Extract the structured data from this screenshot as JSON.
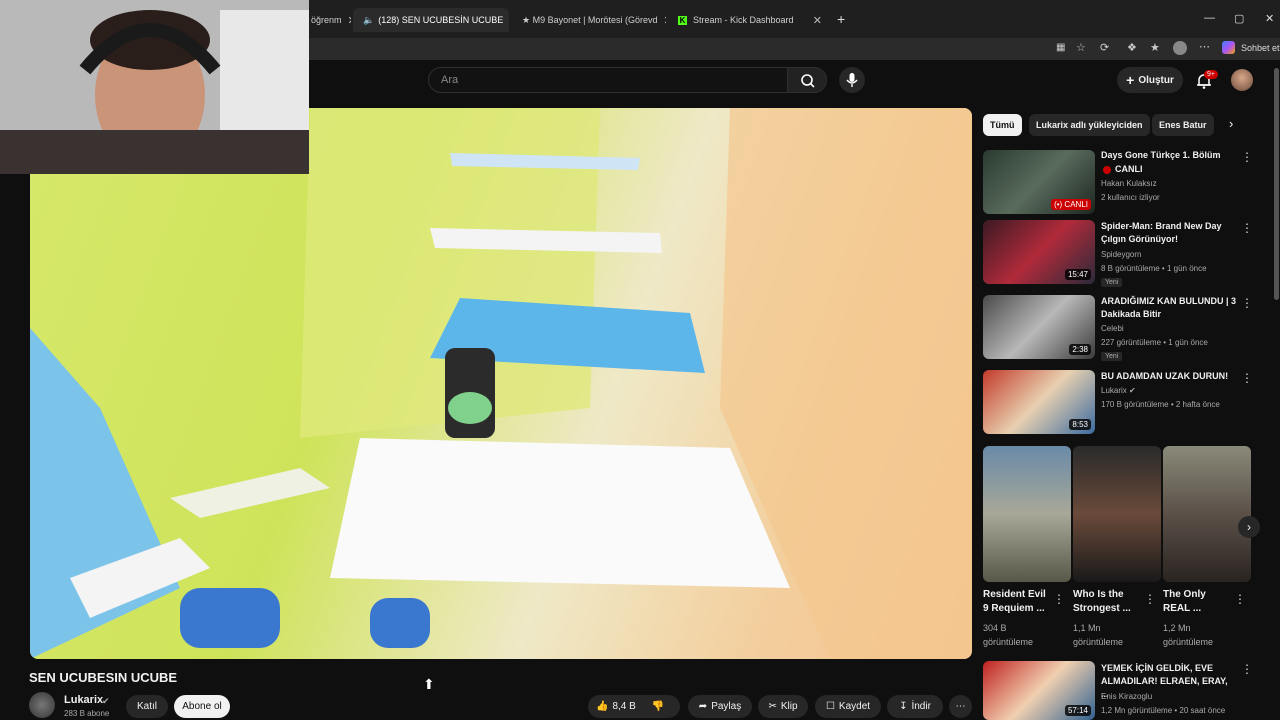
{
  "browser": {
    "tabs": [
      {
        "label": "öğrenm",
        "active": false
      },
      {
        "label": "(128) SEN UCUBESİN UCUBE",
        "active": true
      },
      {
        "label": "★ M9 Bayonet | Morötesi (Görevd",
        "active": false
      },
      {
        "label": "Stream - Kick Dashboard",
        "active": false
      }
    ],
    "new_tab": "+",
    "close_symbol": "✕",
    "sidebar_label": "Sohbet et"
  },
  "header": {
    "search_placeholder": "Ara",
    "create_label": "Oluştur",
    "notif_count": "9+"
  },
  "video": {
    "title": "SEN UCUBESIN UCUBE",
    "channel": "Lukarix",
    "subscribers": "283 B abone",
    "join_label": "Katıl",
    "subscribe_label": "Abone ol",
    "likes": "8,4 B",
    "share_label": "Paylaş",
    "clip_label": "Klip",
    "save_label": "Kaydet",
    "download_label": "İndir"
  },
  "filters": [
    "Tümü",
    "Lukarix adlı yükleyiciden",
    "Enes Batur"
  ],
  "recommendations": [
    {
      "title": "Days Gone Türkçe 1. Bölüm",
      "title2": "CANLI",
      "channel": "Hakan Kulaksız",
      "meta": "2 kullanıcı izliyor",
      "duration": "(•) CANLI",
      "badge": ""
    },
    {
      "title": "Spider-Man: Brand New Day Çılgın Görünüyor!",
      "title2": "",
      "channel": "Spideygorn",
      "meta": "8 B görüntüleme • 1 gün önce",
      "duration": "15:47",
      "badge": "Yeni"
    },
    {
      "title": "ARADIĞIMIZ KAN BULUNDU | 3 Dakikada Bitir",
      "title2": "",
      "channel": "Celebi",
      "meta": "227 görüntüleme • 1 gün önce",
      "duration": "2:38",
      "badge": "Yeni"
    },
    {
      "title": "BU ADAMDAN UZAK DURUN!",
      "title2": "",
      "channel": "Lukarix",
      "meta": "170 B görüntüleme • 2 hafta önce",
      "duration": "8:53",
      "badge": ""
    }
  ],
  "shorts": [
    {
      "title1": "Resident Evil",
      "title2": "9 Requiem ...",
      "views1": "304 B",
      "views2": "görüntüleme"
    },
    {
      "title1": "Who Is the",
      "title2": "Strongest ...",
      "views1": "1,1 Mn",
      "views2": "görüntüleme"
    },
    {
      "title1": "The Only",
      "title2": "REAL ...",
      "views1": "1,2 Mn",
      "views2": "görüntüleme"
    }
  ],
  "last_rec": {
    "title": "YEMEK İÇİN GELDİK, EVE ALMADILAR! ELRAEN, ERAY, ...",
    "channel": "Enis Kirazoglu",
    "meta": "1,2 Mn görüntüleme • 20 saat önce",
    "duration": "57:14"
  },
  "colors": {
    "accent_red": "#ff0000",
    "bg": "#0f0f0f",
    "chip": "#272727",
    "kick_green": "#53fc18"
  }
}
